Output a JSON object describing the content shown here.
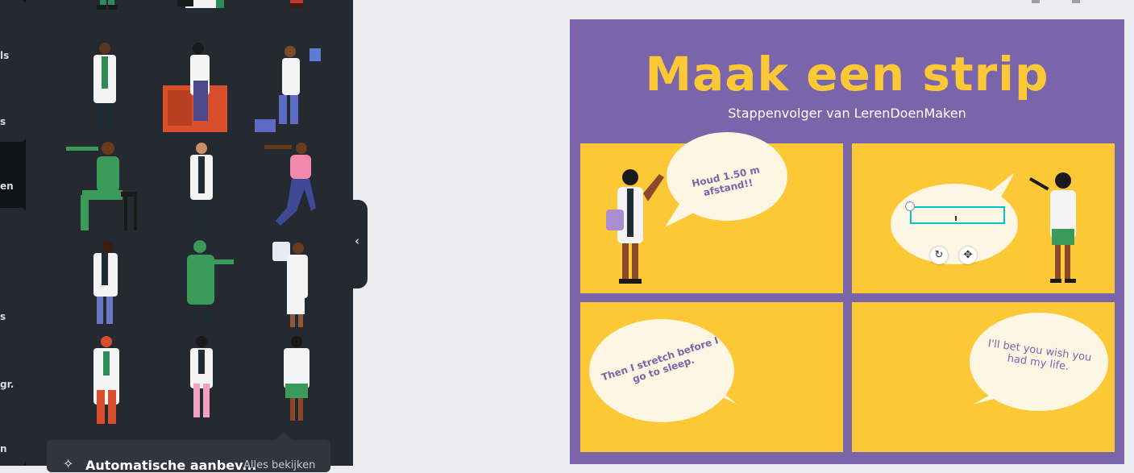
{
  "rail": {
    "labels": [
      "ls",
      "s",
      "en",
      "s",
      "gr.",
      "n"
    ]
  },
  "sidebar": {
    "collapse_glyph": "‹"
  },
  "suggestion_bar": {
    "icon": "sparkle-icon",
    "star_glyph": "✧",
    "label": "Automatische aanbev...",
    "link": "Alles bekijken"
  },
  "design": {
    "title": "Maak een strip",
    "subtitle": "Stappenvolger van LerenDoenMaken",
    "bubbles": {
      "b1": "Houd 1.50 m afstand!!",
      "b3": "Then I stretch before I go to sleep.",
      "b4": "I'll bet you wish you had my life."
    },
    "controls": {
      "rotate_glyph": "↻",
      "move_glyph": "✥"
    }
  },
  "colors": {
    "panel_bg": "#252a31",
    "canvas_bg": "#7a65ab",
    "comic_yellow": "#fcc836",
    "bubble": "#fdf6e3",
    "selection": "#00c4cc"
  }
}
